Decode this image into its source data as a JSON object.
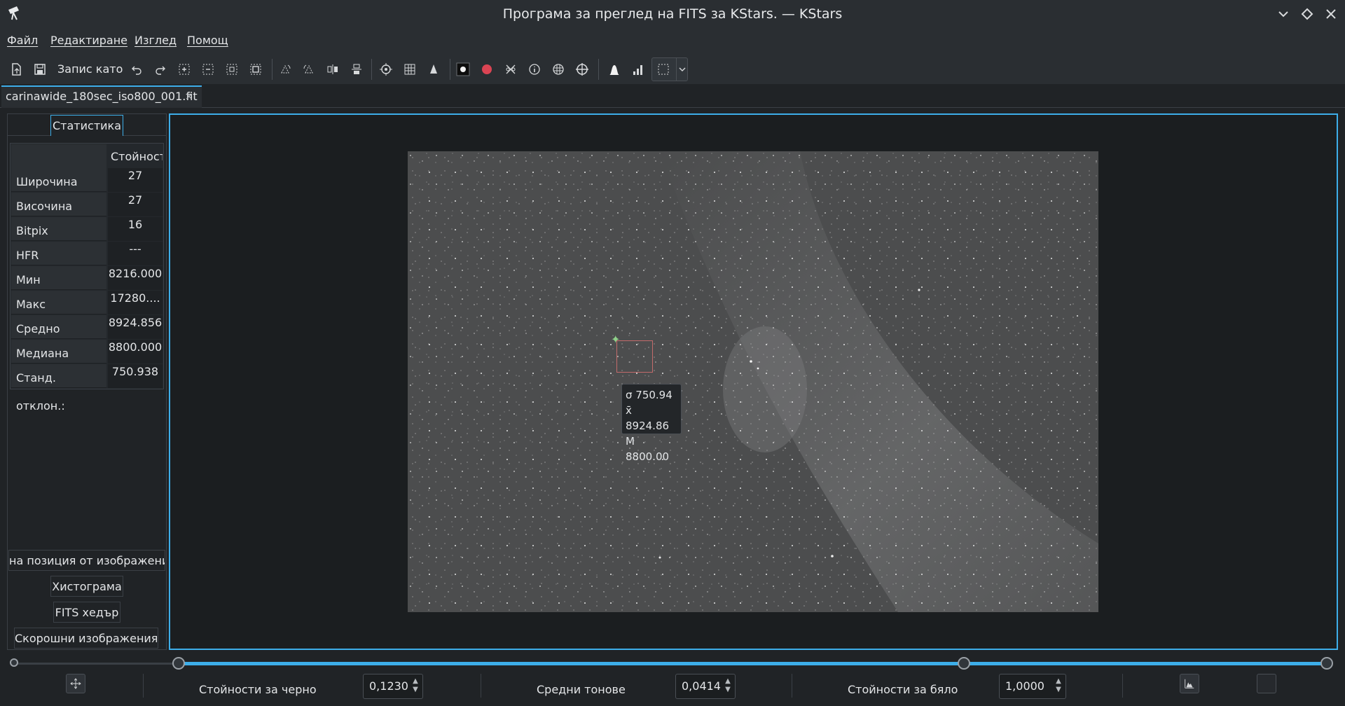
{
  "window": {
    "title": "Програма за преглед на FITS за KStars. — KStars",
    "controls": [
      "minimize-icon",
      "maximize-icon",
      "close-icon"
    ]
  },
  "menubar": {
    "items": [
      "Файл",
      "Редактиране",
      "Изглед",
      "Помощ"
    ]
  },
  "toolbar": {
    "save_as_label": "Запис като",
    "icons": [
      "open-icon",
      "save-icon",
      "undo-icon",
      "redo-icon",
      "zoom-in-icon",
      "zoom-out-icon",
      "zoom-fit-icon",
      "zoom-actual-icon",
      "rotate-cw-icon",
      "rotate-ccw-icon",
      "flip-horizontal-icon",
      "flip-vertical-icon",
      "crosshair-icon",
      "grid-icon",
      "pixel-grid-icon",
      "star-profile-icon",
      "mark-stars-icon",
      "detect-stars-icon",
      "info-icon",
      "objects-icon",
      "target-icon",
      "stretch-icon",
      "histogram-icon",
      "selection-icon"
    ]
  },
  "tab": {
    "label": "carinawide_180sec_iso800_001.fit",
    "close": "×"
  },
  "statistics": {
    "tab_label": "Статистика",
    "value_header": "Стойност",
    "rows": [
      {
        "label": "Широчина",
        "value": "27"
      },
      {
        "label": "Височина",
        "value": "27"
      },
      {
        "label": "Bitpix",
        "value": "16"
      },
      {
        "label": "HFR",
        "value": "---"
      },
      {
        "label": "Мин",
        "value": "8216.000"
      },
      {
        "label": "Макс",
        "value": "17280...."
      },
      {
        "label": "Средно",
        "value": "8924.856"
      },
      {
        "label": "Медиана",
        "value": "8800.000"
      },
      {
        "label": "Станд. отклон.:",
        "value": "750.938"
      }
    ]
  },
  "panel_sections": {
    "position": "на позиция от изображения",
    "histogram": "Хистограма",
    "fits_header": "FITS хедър",
    "recent": "Скорошни изображения"
  },
  "tooltip": {
    "sigma": "σ 750.94",
    "mean": "x̄ 8924.86",
    "median": "M 8800.00"
  },
  "stretch": {
    "black_label": "Стойности за черно",
    "black_value": "0,1230",
    "mid_label": "Средни тонове",
    "mid_value": "0,0414",
    "white_label": "Стойности за бяло",
    "white_value": "1,0000",
    "black_fraction": 0.123,
    "white_fraction": 0.7
  }
}
